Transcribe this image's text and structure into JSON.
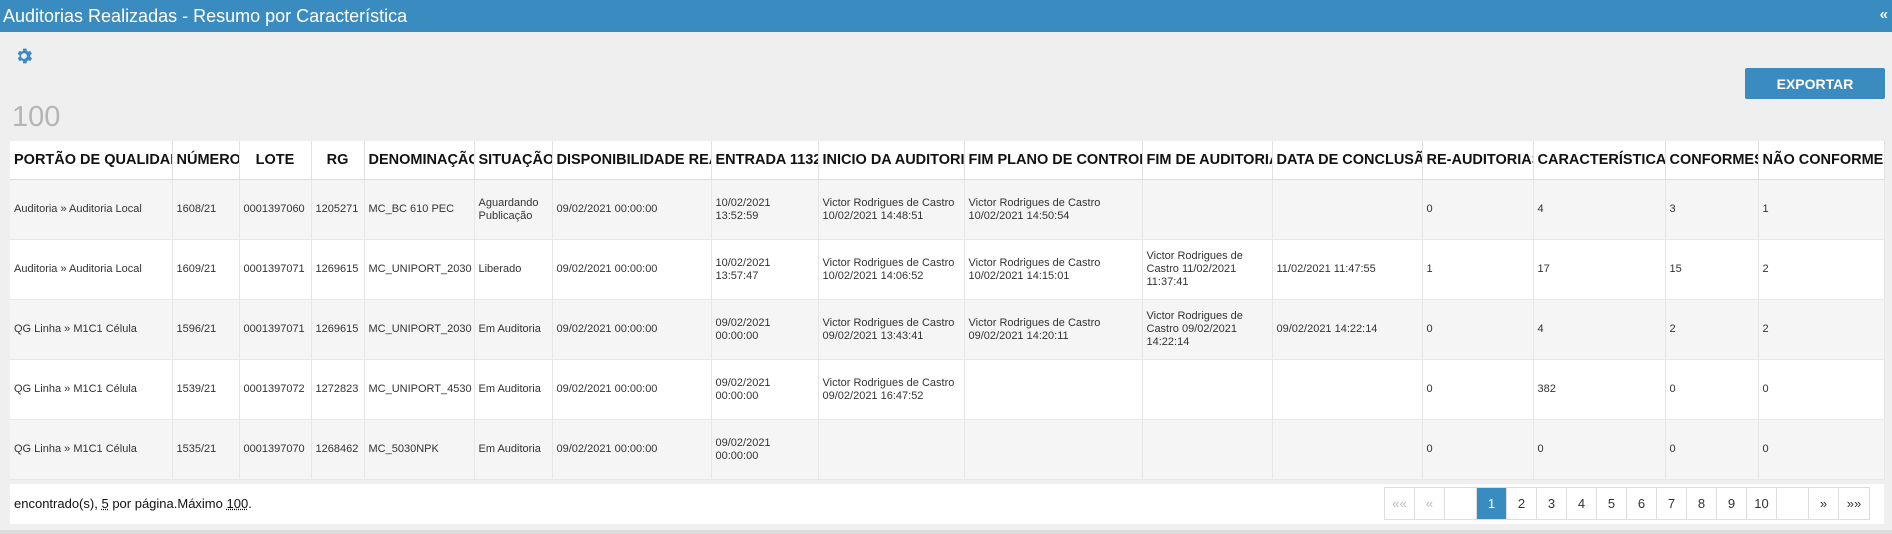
{
  "window": {
    "title": "Auditorias Realizadas - Resumo por Característica",
    "collapse_icon": "«"
  },
  "toolbar": {
    "settings_icon": "gear-icon",
    "export_label": "EXPORTAR"
  },
  "summary": {
    "count": "100"
  },
  "table": {
    "headers": [
      "PORTÃO DE QUALIDADE",
      "NÚMERO",
      "LOTE",
      "RG",
      "DENOMINAÇÃO",
      "SITUAÇÃO",
      "DISPONIBILIDADE REAL",
      "ENTRADA 1132",
      "INICIO DA AUDITORIA",
      "FIM PLANO DE CONTROLE",
      "FIM DE AUDITORIA",
      "DATA DE CONCLUSÃO",
      "RE-AUDITORIAS",
      "CARACTERÍSTICAS",
      "CONFORMES",
      "NÃO CONFORMES"
    ],
    "rows": [
      [
        "Auditoria » Auditoria Local",
        "1608/21",
        "0001397060",
        "1205271",
        "MC_BC 610 PEC",
        "Aguardando Publicação",
        "09/02/2021 00:00:00",
        "10/02/2021 13:52:59",
        "Victor Rodrigues de Castro 10/02/2021 14:48:51",
        "Victor Rodrigues de Castro 10/02/2021 14:50:54",
        "",
        "",
        "0",
        "4",
        "3",
        "1"
      ],
      [
        "Auditoria » Auditoria Local",
        "1609/21",
        "0001397071",
        "1269615",
        "MC_UNIPORT_2030",
        "Liberado",
        "09/02/2021 00:00:00",
        "10/02/2021 13:57:47",
        "Victor Rodrigues de Castro 10/02/2021 14:06:52",
        "Victor Rodrigues de Castro 10/02/2021 14:15:01",
        "Victor Rodrigues de Castro 11/02/2021 11:37:41",
        "11/02/2021 11:47:55",
        "1",
        "17",
        "15",
        "2"
      ],
      [
        "QG Linha » M1C1 Célula",
        "1596/21",
        "0001397071",
        "1269615",
        "MC_UNIPORT_2030",
        "Em Auditoria",
        "09/02/2021 00:00:00",
        "09/02/2021 00:00:00",
        "Victor Rodrigues de Castro 09/02/2021 13:43:41",
        "Victor Rodrigues de Castro 09/02/2021 14:20:11",
        "Victor Rodrigues de Castro 09/02/2021 14:22:14",
        "09/02/2021 14:22:14",
        "0",
        "4",
        "2",
        "2"
      ],
      [
        "QG Linha » M1C1 Célula",
        "1539/21",
        "0001397072",
        "1272823",
        "MC_UNIPORT_4530",
        "Em Auditoria",
        "09/02/2021 00:00:00",
        "09/02/2021 00:00:00",
        "Victor Rodrigues de Castro 09/02/2021 16:47:52",
        "",
        "",
        "",
        "0",
        "382",
        "0",
        "0"
      ],
      [
        "QG Linha » M1C1 Célula",
        "1535/21",
        "0001397070",
        "1268462",
        "MC_5030NPK",
        "Em Auditoria",
        "09/02/2021 00:00:00",
        "09/02/2021 00:00:00",
        "",
        "",
        "",
        "",
        "0",
        "0",
        "0",
        "0"
      ]
    ]
  },
  "footer": {
    "text_prefix": "encontrado(s),",
    "per_page": "5",
    "text_middle": "por página.Máximo",
    "max": "100",
    "text_suffix": "."
  },
  "pagination": {
    "first": "««",
    "prev": "«",
    "next": "»",
    "last": "»»",
    "pages": [
      "1",
      "2",
      "3",
      "4",
      "5",
      "6",
      "7",
      "8",
      "9",
      "10"
    ],
    "current": "1"
  }
}
